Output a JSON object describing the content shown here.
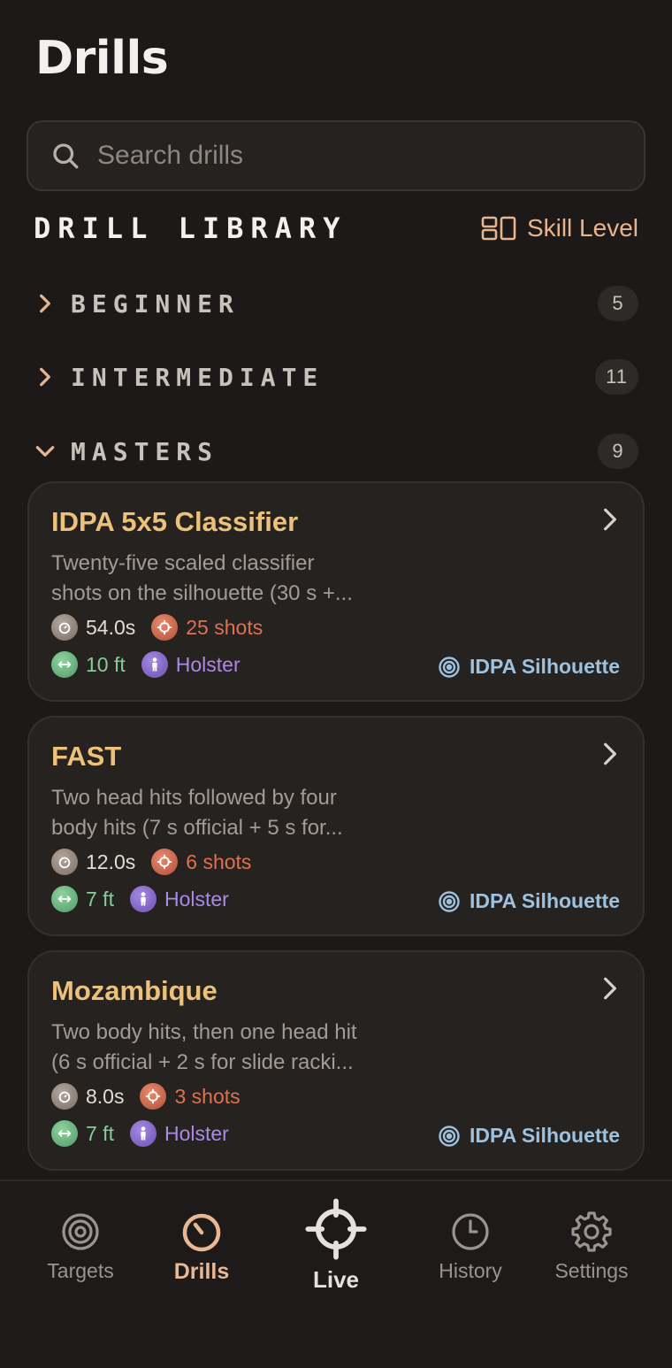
{
  "page": {
    "title": "Drills"
  },
  "search": {
    "placeholder": "Search drills"
  },
  "library": {
    "title": "DRILL LIBRARY",
    "sort_label": "Skill Level"
  },
  "groups": [
    {
      "name": "BEGINNER",
      "count": "5",
      "expanded": false
    },
    {
      "name": "INTERMEDIATE",
      "count": "11",
      "expanded": false
    },
    {
      "name": "MASTERS",
      "count": "9",
      "expanded": true
    }
  ],
  "drills": [
    {
      "title": "IDPA 5x5 Classifier",
      "desc_line1": "Twenty-five scaled classifier",
      "desc_line2": "shots on the silhouette (30 s +...",
      "time": "54.0s",
      "shots": "25 shots",
      "distance": "10 ft",
      "position": "Holster",
      "target": "IDPA Silhouette"
    },
    {
      "title": "FAST",
      "desc_line1": "Two head hits followed by four",
      "desc_line2": "body hits (7 s official + 5 s for...",
      "time": "12.0s",
      "shots": "6 shots",
      "distance": "7 ft",
      "position": "Holster",
      "target": "IDPA Silhouette"
    },
    {
      "title": "Mozambique",
      "desc_line1": "Two body hits, then one head hit",
      "desc_line2": "(6 s official + 2 s for slide racki...",
      "time": "8.0s",
      "shots": "3 shots",
      "distance": "7 ft",
      "position": "Holster",
      "target": "IDPA Silhouette"
    }
  ],
  "tabs": [
    {
      "label": "Targets",
      "icon": "target-icon"
    },
    {
      "label": "Drills",
      "icon": "timer-icon",
      "active": true
    },
    {
      "label": "Live",
      "icon": "crosshair-icon"
    },
    {
      "label": "History",
      "icon": "clock-icon"
    },
    {
      "label": "Settings",
      "icon": "gear-icon"
    }
  ],
  "colors": {
    "background": "#1c1918",
    "accent": "#e7b893",
    "card_title": "#ecc27a",
    "shots": "#e0704f",
    "distance": "#86cc98",
    "position": "#a98ae6",
    "target": "#9cc2e0"
  }
}
